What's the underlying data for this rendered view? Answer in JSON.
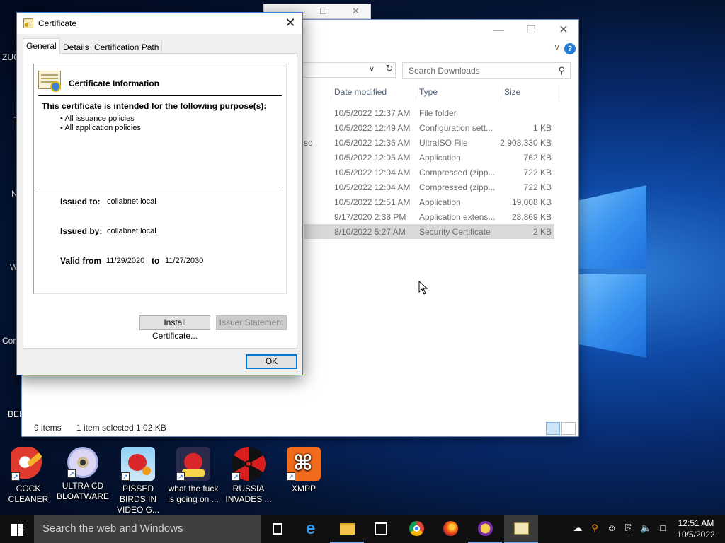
{
  "desktop": {
    "icons": [
      {
        "label": "COCK CLEANER",
        "icon": "ccleaner-icon"
      },
      {
        "label": "ULTRA CD BLOATWARE",
        "icon": "disc-icon"
      },
      {
        "label": "PISSED BIRDS IN VIDEO G...",
        "icon": "angry-bird-icon"
      },
      {
        "label": "what the fuck is going on ...",
        "icon": "angry-birds-space-icon"
      },
      {
        "label": "RUSSIA INVADES ...",
        "icon": "radiation-icon"
      },
      {
        "label": "XMPP",
        "icon": "xampp-icon"
      }
    ],
    "partial_labels": [
      "ZUC",
      "T",
      "N",
      "W",
      "Cor",
      "BEEF"
    ]
  },
  "explorer": {
    "search_placeholder": "Search Downloads",
    "columns": [
      "Date modified",
      "Type",
      "Size"
    ],
    "rows": [
      {
        "name": "",
        "date": "10/5/2022 12:37 AM",
        "type": "File folder",
        "size": ""
      },
      {
        "name": "",
        "date": "10/5/2022 12:49 AM",
        "type": "Configuration sett...",
        "size": "1 KB"
      },
      {
        "name": "so",
        "date": "10/5/2022 12:36 AM",
        "type": "UltraISO File",
        "size": "2,908,330 KB"
      },
      {
        "name": "",
        "date": "10/5/2022 12:05 AM",
        "type": "Application",
        "size": "762 KB"
      },
      {
        "name": "",
        "date": "10/5/2022 12:04 AM",
        "type": "Compressed (zipp...",
        "size": "722 KB"
      },
      {
        "name": "",
        "date": "10/5/2022 12:04 AM",
        "type": "Compressed (zipp...",
        "size": "722 KB"
      },
      {
        "name": "",
        "date": "10/5/2022 12:51 AM",
        "type": "Application",
        "size": "19,008 KB"
      },
      {
        "name": "",
        "date": "9/17/2020 2:38 PM",
        "type": "Application extens...",
        "size": "28,869 KB"
      },
      {
        "name": "",
        "date": "8/10/2022 5:27 AM",
        "type": "Security Certificate",
        "size": "2 KB",
        "selected": true
      }
    ],
    "status": {
      "items": "9 items",
      "selection": "1 item selected  1.02 KB"
    }
  },
  "certificate": {
    "title": "Certificate",
    "tabs": [
      "General",
      "Details",
      "Certification Path"
    ],
    "active_tab": "General",
    "info_title": "Certificate Information",
    "purpose_heading": "This certificate is intended for the following purpose(s):",
    "purposes": [
      "All issuance policies",
      "All application policies"
    ],
    "issued_to_label": "Issued to:",
    "issued_to": "collabnet.local",
    "issued_by_label": "Issued by:",
    "issued_by": "collabnet.local",
    "valid_from_label": "Valid from",
    "valid_from": "11/29/2020",
    "to_label": "to",
    "valid_to": "11/27/2030",
    "install_button": "Install Certificate...",
    "issuer_button": "Issuer Statement",
    "ok_button": "OK"
  },
  "taskbar": {
    "search_placeholder": "Search the web and Windows",
    "apps": [
      "task-view-icon",
      "edge-icon",
      "file-explorer-icon",
      "store-icon",
      "chrome-icon",
      "firefox-icon",
      "app-icon",
      "certificate-icon"
    ],
    "clock_time": "12:51 AM",
    "clock_date": "10/5/2022"
  },
  "colors": {
    "accent": "#0078d7",
    "taskbar": "#101010",
    "selection": "#d9d9d9"
  }
}
